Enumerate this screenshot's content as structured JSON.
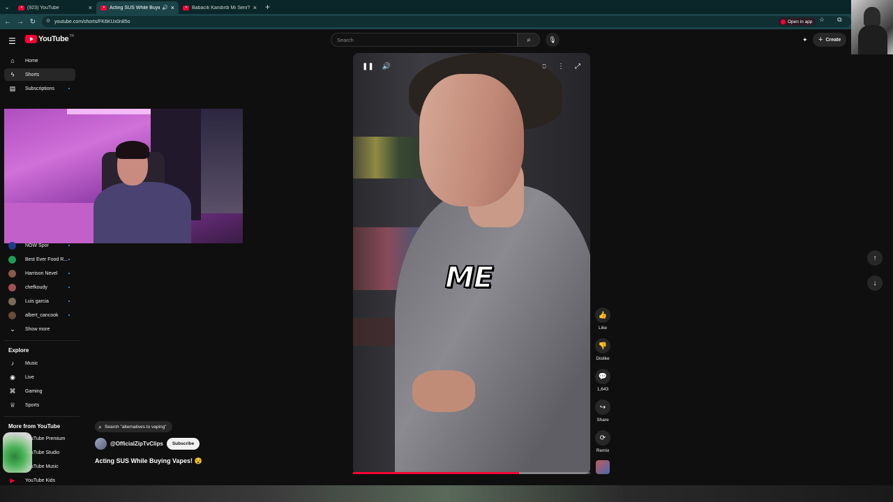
{
  "browser": {
    "tabs": [
      {
        "title": "(923) YouTube",
        "active": false
      },
      {
        "title": "Acting SUS While Buying V",
        "active": true
      },
      {
        "title": "Babacık Kandırdı Mı Seni? - Yo",
        "active": false
      }
    ],
    "url": "youtube.com/shorts/FK6KUx0n85o",
    "open_in_app": "Open in app"
  },
  "masthead": {
    "logo_text": "YouTube",
    "country_code": "TR",
    "search_placeholder": "Search",
    "create_label": "Create"
  },
  "sidebar": {
    "main": [
      {
        "label": "Home",
        "icon": "home-icon"
      },
      {
        "label": "Shorts",
        "icon": "shorts-icon",
        "active": true
      },
      {
        "label": "Subscriptions",
        "icon": "subscriptions-icon"
      }
    ],
    "subscriptions": [
      {
        "label": "NOW Spor",
        "color": "#1e3a8a"
      },
      {
        "label": "Best Ever Food R...",
        "color": "#1f9d55"
      },
      {
        "label": "Harrison Nevel",
        "color": "#8a5a4a"
      },
      {
        "label": "chefkoudy",
        "color": "#a05050"
      },
      {
        "label": "Luis garcia",
        "color": "#7a6a5a"
      },
      {
        "label": "albert_cancook",
        "color": "#6a4a3a"
      }
    ],
    "show_more": "Show more",
    "explore_title": "Explore",
    "explore": [
      {
        "label": "Music",
        "icon": "music-icon"
      },
      {
        "label": "Live",
        "icon": "live-icon"
      },
      {
        "label": "Gaming",
        "icon": "gaming-icon"
      },
      {
        "label": "Sports",
        "icon": "trophy-icon"
      }
    ],
    "more_title": "More from YouTube",
    "more": [
      {
        "label": "YouTube Premium"
      },
      {
        "label": "YouTube Studio"
      },
      {
        "label": "YouTube Music"
      },
      {
        "label": "YouTube Kids"
      }
    ]
  },
  "short": {
    "caption": "ME",
    "progress": 0.7,
    "search_suggestion": "Search \"alternatives to vaping\"",
    "channel": "@OfficialZipTvClips",
    "subscribe_label": "Subscribe",
    "title": "Acting SUS While Buying Vapes! 😵",
    "actions": {
      "like": "Like",
      "dislike": "Dislike",
      "comments": "1,643",
      "share": "Share",
      "remix": "Remix"
    }
  }
}
